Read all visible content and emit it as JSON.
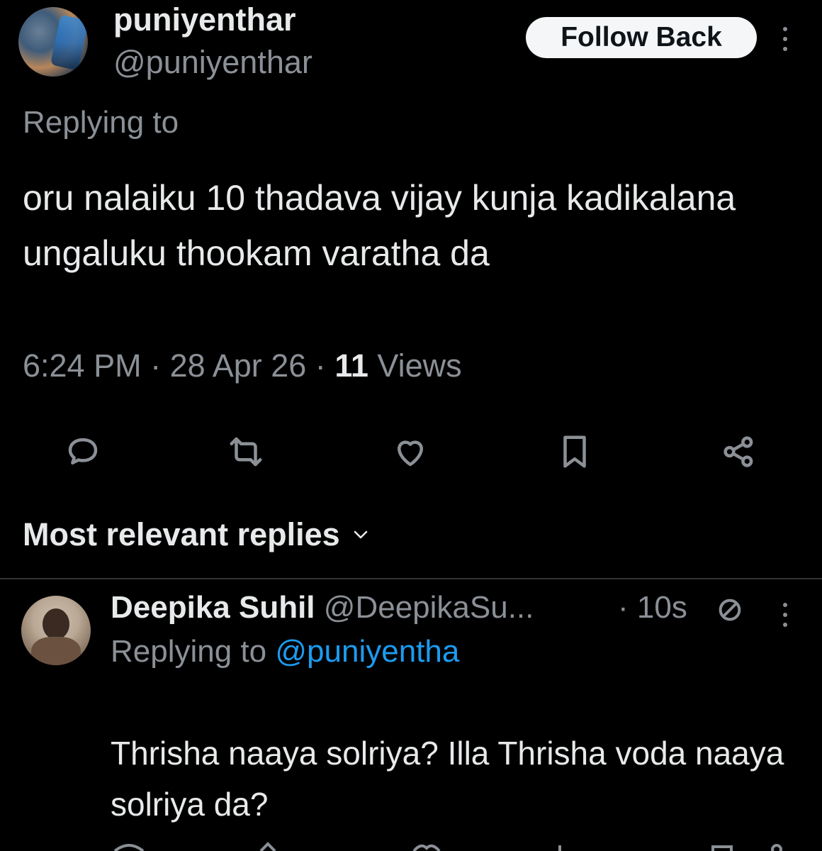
{
  "tweet": {
    "display_name": "puniyenthar",
    "handle": "@puniyenthar",
    "follow_label": "Follow Back",
    "replying_label": "Replying to",
    "text": "oru nalaiku 10 thadava vijay kunja kadikalana ungaluku thookam varatha da",
    "time": "6:24 PM",
    "date": "28 Apr 26",
    "views_count": "11",
    "views_label": "Views",
    "separator": "·",
    "actions": [
      "reply-icon",
      "retweet-icon",
      "like-icon",
      "bookmark-icon",
      "share-icon"
    ]
  },
  "replies_header": {
    "sort_label": "Most relevant replies"
  },
  "reply": {
    "display_name": "Deepika Suhil",
    "handle": "@DeepikaSu...",
    "time": "· 10s",
    "replying_label": "Replying to",
    "replying_to": "@puniyentha",
    "text": "Thrisha naaya solriya? Illa Thrisha voda naaya solriya da?"
  },
  "colors": {
    "background": "#000000",
    "text": "#e7e9ea",
    "muted": "#8b9096",
    "link": "#1d9bf0",
    "button_bg": "#f4f6f7"
  }
}
